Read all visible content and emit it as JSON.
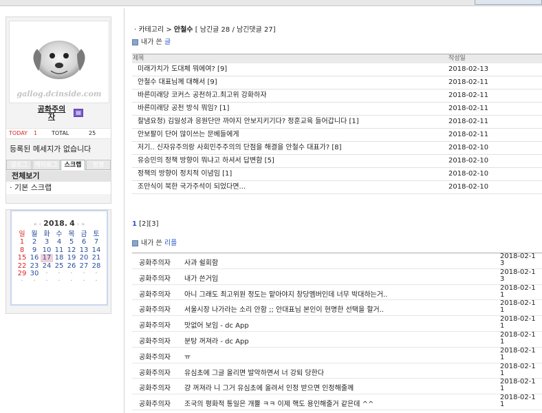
{
  "sidebar": {
    "photo_caption": "gallog.dcinside.com",
    "nickname": "공화주의자",
    "stats": {
      "today_label": "TODAY",
      "today": "1",
      "total_label": "TOTAL",
      "total": "25"
    },
    "message": "등록된 메세지가 없습니다",
    "tabs": [
      {
        "label": "갤로그"
      },
      {
        "label": "메이로그"
      },
      {
        "label": "스크랩"
      },
      {
        "label": "방명"
      }
    ],
    "scrap_all": "전체보기",
    "scrap_basic": "· 기본 스크랩",
    "calendar": {
      "prev_year": "«",
      "prev_month": "‹",
      "year": "2018.",
      "month": "4",
      "next_month": "›",
      "next_year": "»",
      "weekdays": [
        "일",
        "월",
        "화",
        "수",
        "목",
        "금",
        "토"
      ],
      "weeks": [
        [
          "1",
          "2",
          "3",
          "4",
          "5",
          "6",
          "7"
        ],
        [
          "8",
          "9",
          "10",
          "11",
          "12",
          "13",
          "14"
        ],
        [
          "15",
          "16",
          "17",
          "18",
          "19",
          "20",
          "21"
        ],
        [
          "22",
          "23",
          "24",
          "25",
          "26",
          "27",
          "28"
        ],
        [
          "29",
          "30",
          "·",
          "·",
          "·",
          "·",
          "·"
        ],
        [
          "·",
          "·",
          "·",
          "·",
          "·",
          "·",
          "·"
        ]
      ],
      "today": "17"
    }
  },
  "main": {
    "breadcrumb": {
      "prefix": "· 카테고리 > ",
      "category": "안철수",
      "suffix": " [ 남긴글 28 / 남긴댓글 27]"
    },
    "posts_title": {
      "prefix": "내가 쓴 ",
      "accent": "글"
    },
    "posts_header": {
      "title": "제목",
      "date": "작성일"
    },
    "posts": [
      {
        "title": "미래가치가 도대체 뭐에여? [9]",
        "date": "2018-02-13"
      },
      {
        "title": "안철수 대표님께 대해서 [9]",
        "date": "2018-02-11"
      },
      {
        "title": "바른미래당 코커스 공천하고.최고위 강화하자",
        "date": "2018-02-11"
      },
      {
        "title": "바른미래당 공천 방식 뭐임? [1]",
        "date": "2018-02-11"
      },
      {
        "title": "찰냄요청) 김일성과 응원단만 까야지 안보지키기다? 정훈교육 들어갑니다 [1]",
        "date": "2018-02-11"
      },
      {
        "title": "안보팔이 단어 많이쓰는 문베들에게",
        "date": "2018-02-11"
      },
      {
        "title": "저기.. 신자유주의랑 사회민주주의의 단점을 해결을 안철수 대표가? [8]",
        "date": "2018-02-10"
      },
      {
        "title": "유승민의 정책 방향이 뭐냐고 하셔서 답변함 [5]",
        "date": "2018-02-10"
      },
      {
        "title": "정책의 방향이 정치적 이념임 [1]",
        "date": "2018-02-10"
      },
      {
        "title": "조만식이 북한 국가주석이 되었다면...",
        "date": "2018-02-10"
      }
    ],
    "pager": {
      "current": "1",
      "others": " [2][3]"
    },
    "replies_title": {
      "prefix": "내가 쓴 ",
      "accent": "리플"
    },
    "replies": [
      {
        "author": "공화주의자",
        "content": "사과 쉴회함",
        "date": "2018-02-13"
      },
      {
        "author": "공화주의자",
        "content": "내가 쓴거임",
        "date": "2018-02-13"
      },
      {
        "author": "공화주의자",
        "content": "아니 그래도 최고위원 정도는 맡아야지 창당멤버인데 너무 박대하는거..",
        "date": "2018-02-11"
      },
      {
        "author": "공화주의자",
        "content": "서울시장 나가라는 소리 안함 ;; 안대표님 본인이 현명한 선택을 할거..",
        "date": "2018-02-11"
      },
      {
        "author": "공화주의자",
        "content": "맛없어 보임 - dc App",
        "date": "2018-02-11"
      },
      {
        "author": "공화주의자",
        "content": "분탕 꺼져라 - dc App",
        "date": "2018-02-11"
      },
      {
        "author": "공화주의자",
        "content": "ㅠ",
        "date": "2018-02-11"
      },
      {
        "author": "공화주의자",
        "content": "유심초에 그글 올리면 발악하면서 너 강퇴 당한다",
        "date": "2018-02-11"
      },
      {
        "author": "공화주의자",
        "content": "걍 꺼져라 니 그거 유심초에 올려서 인정 받으면 인정해줄께",
        "date": "2018-02-11"
      },
      {
        "author": "공화주의자",
        "content": "조국의 평화적 통일은 개뿔 ㅋㅋ 이제 핵도 용인해줄거 같은데 ^^",
        "date": "2018-02-11"
      }
    ]
  }
}
